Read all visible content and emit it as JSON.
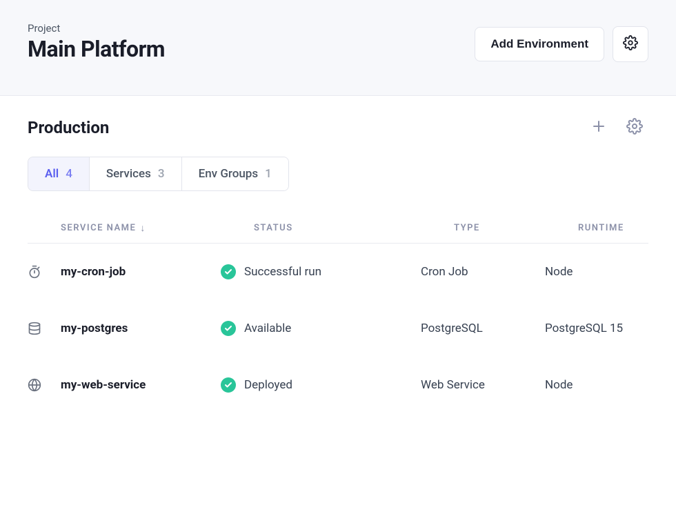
{
  "header": {
    "project_label": "Project",
    "project_title": "Main Platform",
    "add_env_label": "Add Environment"
  },
  "environment": {
    "title": "Production"
  },
  "tabs": [
    {
      "label": "All",
      "count": "4",
      "active": true
    },
    {
      "label": "Services",
      "count": "3",
      "active": false
    },
    {
      "label": "Env Groups",
      "count": "1",
      "active": false
    }
  ],
  "table": {
    "headers": {
      "name": "SERVICE NAME",
      "status": "STATUS",
      "type": "TYPE",
      "runtime": "RUNTIME"
    },
    "rows": [
      {
        "icon": "timer",
        "name": "my-cron-job",
        "status": "Successful run",
        "type": "Cron Job",
        "runtime": "Node"
      },
      {
        "icon": "database",
        "name": "my-postgres",
        "status": "Available",
        "type": "PostgreSQL",
        "runtime": "PostgreSQL 15"
      },
      {
        "icon": "globe",
        "name": "my-web-service",
        "status": "Deployed",
        "type": "Web Service",
        "runtime": "Node"
      }
    ]
  }
}
